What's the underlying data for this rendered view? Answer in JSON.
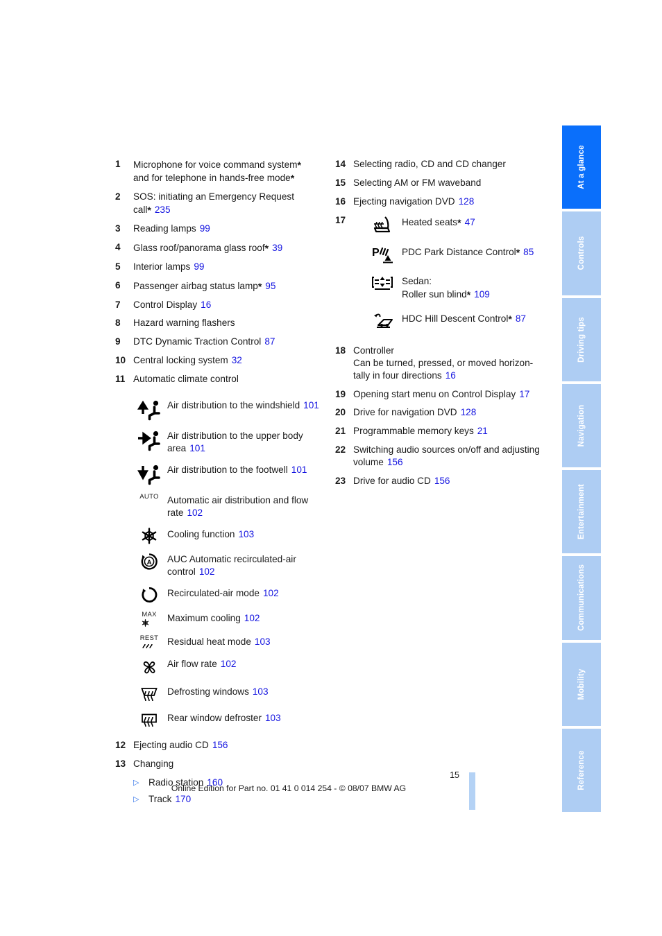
{
  "page": {
    "number": "15",
    "footer": "Online Edition for Part no. 01 41 0 014 254 - © 08/07 BMW AG",
    "link_color": "#1414e0",
    "active_tab_color": "#0a6ffb",
    "inactive_tab_color": "#aecdf3",
    "edge_bar_color": "#b4d2f5"
  },
  "left_column": {
    "entries": [
      {
        "num": "1",
        "text": "Microphone for voice command system",
        "star": "*",
        "text2": "and for telephone in hands-free mode",
        "star2": "*",
        "page": ""
      },
      {
        "num": "2",
        "text": "SOS: initiating an Emergency Request",
        "text2": "call",
        "star2": "*",
        "page": "235"
      },
      {
        "num": "3",
        "text": "Reading lamps",
        "page": "99"
      },
      {
        "num": "4",
        "text": "Glass roof/panorama glass roof",
        "star": "*",
        "page": "39"
      },
      {
        "num": "5",
        "text": "Interior lamps",
        "page": "99"
      },
      {
        "num": "6",
        "text": "Passenger airbag status lamp",
        "star": "*",
        "page": "95"
      },
      {
        "num": "7",
        "text": "Control Display",
        "page": "16"
      },
      {
        "num": "8",
        "text": "Hazard warning flashers",
        "page": ""
      },
      {
        "num": "9",
        "text": "DTC Dynamic Traction Control",
        "page": "87"
      },
      {
        "num": "10",
        "text": "Central locking system",
        "page": "32"
      },
      {
        "num": "11",
        "text": "Automatic climate control",
        "page": ""
      }
    ],
    "climate_icons": [
      {
        "icon": "air-distribution-windshield-icon",
        "label": "Air distribution to the windshield",
        "page": "101"
      },
      {
        "icon": "air-distribution-upper-body-icon",
        "label": "Air distribution to the upper body area",
        "page": "101"
      },
      {
        "icon": "air-distribution-footwell-icon",
        "label": "Air distribution to the footwell",
        "page": "101"
      },
      {
        "icon": "auto-text-icon",
        "label": "Automatic air distribution and flow rate",
        "page": "102"
      },
      {
        "icon": "snowflake-cooling-icon",
        "label": "Cooling function",
        "page": "103"
      },
      {
        "icon": "auc-recirculated-air-icon",
        "label": "AUC Automatic recirculated-air control",
        "page": "102"
      },
      {
        "icon": "recirculated-air-mode-icon",
        "label": "Recirculated-air mode",
        "page": "102"
      },
      {
        "icon": "max-cooling-icon",
        "label": "Maximum cooling",
        "page": "102"
      },
      {
        "icon": "rest-heat-icon",
        "label": "Residual heat mode",
        "page": "103"
      },
      {
        "icon": "fan-airflow-icon",
        "label": "Air flow rate",
        "page": "102"
      },
      {
        "icon": "defrost-windshield-icon",
        "label": "Defrosting windows",
        "page": "103"
      },
      {
        "icon": "rear-window-defroster-icon",
        "label": "Rear window defroster",
        "page": "103"
      }
    ],
    "entries_after": [
      {
        "num": "12",
        "text": "Ejecting audio CD",
        "page": "156"
      },
      {
        "num": "13",
        "text": "Changing",
        "page": ""
      }
    ],
    "sub_bullets": [
      {
        "text": "Radio station",
        "page": "160"
      },
      {
        "text": "Track",
        "page": "170"
      }
    ]
  },
  "right_column": {
    "entries_top": [
      {
        "num": "14",
        "text": "Selecting radio, CD and CD changer",
        "page": ""
      },
      {
        "num": "15",
        "text": "Selecting AM or FM waveband",
        "page": ""
      },
      {
        "num": "16",
        "text": "Ejecting navigation DVD",
        "page": "128"
      }
    ],
    "group_17": {
      "num": "17",
      "rows": [
        {
          "icon": "heated-seat-icon",
          "label": "Heated seats",
          "star": "*",
          "page": "47"
        },
        {
          "icon": "pdc-park-distance-icon",
          "label": "PDC Park Distance Control",
          "star": "*",
          "page": "85"
        },
        {
          "icon": "roller-sun-blind-icon",
          "label_line1": "Sedan:",
          "label": "Roller sun blind",
          "star": "*",
          "page": "109"
        },
        {
          "icon": "hdc-hill-descent-icon",
          "label": "HDC Hill Descent Control",
          "star": "*",
          "page": "87"
        }
      ]
    },
    "entries_bottom": [
      {
        "num": "18",
        "text": "Controller",
        "page": "16",
        "text2": "Can be turned, pressed, or moved horizon-tally in four directions"
      },
      {
        "num": "19",
        "text": "Opening start menu on Control Display",
        "page": "17"
      },
      {
        "num": "20",
        "text": "Drive for navigation DVD",
        "page": "128"
      },
      {
        "num": "21",
        "text": "Programmable memory keys",
        "page": "21"
      },
      {
        "num": "22",
        "text": "Switching audio sources on/off and adjusting volume",
        "page": "156"
      },
      {
        "num": "23",
        "text": "Drive for audio CD",
        "page": "156"
      }
    ]
  },
  "tabs": [
    {
      "label": "At a glance",
      "active": true
    },
    {
      "label": "Controls",
      "active": false
    },
    {
      "label": "Driving tips",
      "active": false
    },
    {
      "label": "Navigation",
      "active": false
    },
    {
      "label": "Entertainment",
      "active": false
    },
    {
      "label": "Communications",
      "active": false
    },
    {
      "label": "Mobility",
      "active": false
    },
    {
      "label": "Reference",
      "active": false
    }
  ]
}
